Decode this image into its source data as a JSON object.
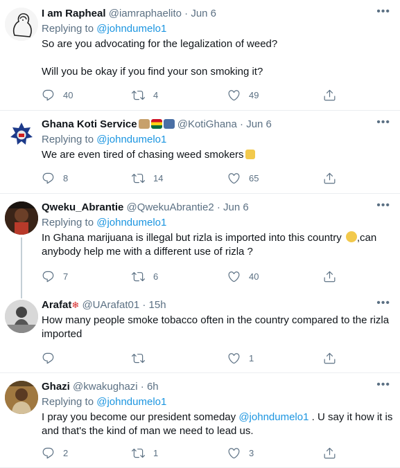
{
  "colors": {
    "link": "#1b95e0",
    "muted": "#5b7083",
    "text": "#0f1419",
    "border": "#ebeef0"
  },
  "tweets": [
    {
      "name": "I am Rapheal",
      "handle": "@iamraphaelito",
      "time": "· Jun 6",
      "replying_label": "Replying to",
      "replying_to": "@johndumelo1",
      "lines": [
        "So are you advocating for the legalization of weed?",
        "Will you be okay if you find your son smoking it?"
      ],
      "replies": "40",
      "retweets": "4",
      "likes": "49"
    },
    {
      "name": "Ghana Koti Service",
      "handle": "@KotiGhana",
      "time": "· Jun 6",
      "replying_label": "Replying to",
      "replying_to": "@johndumelo1",
      "text": "We are even tired of chasing weed smokers",
      "replies": "8",
      "retweets": "14",
      "likes": "65"
    },
    {
      "name": "Qweku_Abrantie",
      "handle": "@QwekuAbrantie2",
      "time": "· Jun 6",
      "replying_label": "Replying to",
      "replying_to": "@johndumelo1",
      "text_a": "In Ghana marijuana is illegal but rizla is imported into this country",
      "text_b": ",can anybody help me with a different use of rizla ?",
      "replies": "7",
      "retweets": "6",
      "likes": "40"
    },
    {
      "name": "Arafat",
      "handle": "@UArafat01",
      "time": "· 15h",
      "text": "How many people smoke tobacco often in the country compared to the rizla imported",
      "likes": "1"
    },
    {
      "name": "Ghazi",
      "handle": "@kwakughazi",
      "time": "· 6h",
      "replying_label": "Replying to",
      "replying_to": "@johndumelo1",
      "text_a": "I pray you become our president someday",
      "mention": "@johndumelo1",
      "text_b": ". U say it how it is and that's the kind of man we need to lead us.",
      "replies": "2",
      "retweets": "1",
      "likes": "3"
    }
  ],
  "icons": {
    "reply": "reply-icon",
    "retweet": "retweet-icon",
    "like": "like-icon",
    "share": "share-icon",
    "more": "more-icon"
  }
}
